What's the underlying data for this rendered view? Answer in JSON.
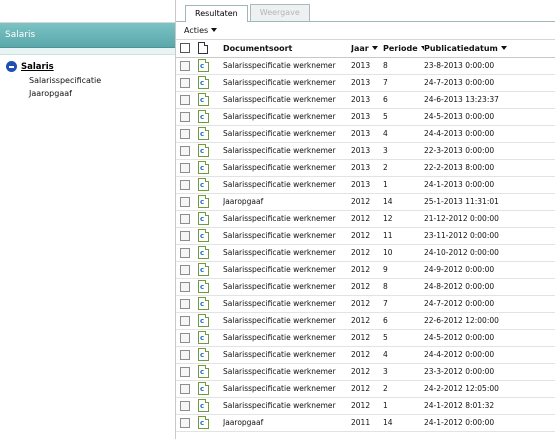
{
  "sidebar": {
    "section_title": "Salaris",
    "tree": {
      "root_label": "Salaris",
      "children": [
        "Salarisspecificatie",
        "Jaaropgaaf"
      ]
    }
  },
  "tabs": [
    {
      "label": "Resultaten",
      "active": true
    },
    {
      "label": "Weergave",
      "active": false
    }
  ],
  "actions_label": "Acties",
  "table": {
    "columns": [
      "Documentsoort",
      "Jaar",
      "Periode",
      "Publicatiedatum"
    ],
    "rows": [
      {
        "doc": "Salarisspecificatie werknemer",
        "year": "2013",
        "period": "8",
        "date": "23-8-2013 0:00:00"
      },
      {
        "doc": "Salarisspecificatie werknemer",
        "year": "2013",
        "period": "7",
        "date": "24-7-2013 0:00:00"
      },
      {
        "doc": "Salarisspecificatie werknemer",
        "year": "2013",
        "period": "6",
        "date": "24-6-2013 13:23:37"
      },
      {
        "doc": "Salarisspecificatie werknemer",
        "year": "2013",
        "period": "5",
        "date": "24-5-2013 0:00:00"
      },
      {
        "doc": "Salarisspecificatie werknemer",
        "year": "2013",
        "period": "4",
        "date": "24-4-2013 0:00:00"
      },
      {
        "doc": "Salarisspecificatie werknemer",
        "year": "2013",
        "period": "3",
        "date": "22-3-2013 0:00:00"
      },
      {
        "doc": "Salarisspecificatie werknemer",
        "year": "2013",
        "period": "2",
        "date": "22-2-2013 8:00:00"
      },
      {
        "doc": "Salarisspecificatie werknemer",
        "year": "2013",
        "period": "1",
        "date": "24-1-2013 0:00:00"
      },
      {
        "doc": "Jaaropgaaf",
        "year": "2012",
        "period": "14",
        "date": "25-1-2013 11:31:01"
      },
      {
        "doc": "Salarisspecificatie werknemer",
        "year": "2012",
        "period": "12",
        "date": "21-12-2012 0:00:00"
      },
      {
        "doc": "Salarisspecificatie werknemer",
        "year": "2012",
        "period": "11",
        "date": "23-11-2012 0:00:00"
      },
      {
        "doc": "Salarisspecificatie werknemer",
        "year": "2012",
        "period": "10",
        "date": "24-10-2012 0:00:00"
      },
      {
        "doc": "Salarisspecificatie werknemer",
        "year": "2012",
        "period": "9",
        "date": "24-9-2012 0:00:00"
      },
      {
        "doc": "Salarisspecificatie werknemer",
        "year": "2012",
        "period": "8",
        "date": "24-8-2012 0:00:00"
      },
      {
        "doc": "Salarisspecificatie werknemer",
        "year": "2012",
        "period": "7",
        "date": "24-7-2012 0:00:00"
      },
      {
        "doc": "Salarisspecificatie werknemer",
        "year": "2012",
        "period": "6",
        "date": "22-6-2012 12:00:00"
      },
      {
        "doc": "Salarisspecificatie werknemer",
        "year": "2012",
        "period": "5",
        "date": "24-5-2012 0:00:00"
      },
      {
        "doc": "Salarisspecificatie werknemer",
        "year": "2012",
        "period": "4",
        "date": "24-4-2012 0:00:00"
      },
      {
        "doc": "Salarisspecificatie werknemer",
        "year": "2012",
        "period": "3",
        "date": "23-3-2012 0:00:00"
      },
      {
        "doc": "Salarisspecificatie werknemer",
        "year": "2012",
        "period": "2",
        "date": "24-2-2012 12:05:00"
      },
      {
        "doc": "Salarisspecificatie werknemer",
        "year": "2012",
        "period": "1",
        "date": "24-1-2012 8:01:32"
      },
      {
        "doc": "Jaaropgaaf",
        "year": "2011",
        "period": "14",
        "date": "24-1-2012 0:00:00"
      }
    ]
  },
  "icons": {
    "collapse": "minus-circle-icon",
    "sort": "sort-desc-icon",
    "document": "document-icon",
    "checkbox": "checkbox-icon"
  },
  "colors": {
    "section_header": "#68b4b6",
    "tree_toggle": "#1f4fb5",
    "doc_icon_border": "#6f9b3c",
    "doc_icon_glyph": "#1c6ecb"
  }
}
